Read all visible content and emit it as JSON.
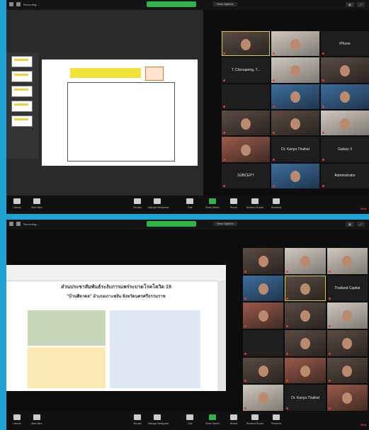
{
  "colors": {
    "background": "#1fa3d6",
    "accent_green": "#2fb34a",
    "active_speaker": "#d6d03c",
    "end": "#e8493f"
  },
  "frame1": {
    "topbar": {
      "left_text": "Recording...",
      "view": "View Options"
    },
    "tiles": [
      {
        "name": "",
        "cam": "cam",
        "active": true
      },
      {
        "name": "",
        "cam": "cam2"
      },
      {
        "name": "iPhone",
        "cam": ""
      },
      {
        "name": "T. Chirnapong, T...",
        "cam": ""
      },
      {
        "name": "",
        "cam": "cam2"
      },
      {
        "name": "",
        "cam": "cam"
      },
      {
        "name": "",
        "cam": ""
      },
      {
        "name": "",
        "cam": "cam4"
      },
      {
        "name": "",
        "cam": "cam4"
      },
      {
        "name": "",
        "cam": "cam"
      },
      {
        "name": "",
        "cam": "cam"
      },
      {
        "name": "",
        "cam": "cam2"
      },
      {
        "name": "",
        "cam": "cam3"
      },
      {
        "name": "Dr. Kanya Thaihal",
        "cam": ""
      },
      {
        "name": "Galaxy 3",
        "cam": ""
      },
      {
        "name": "SUBCEPT",
        "cam": ""
      },
      {
        "name": "",
        "cam": "cam4"
      },
      {
        "name": "Administrator",
        "cam": ""
      }
    ]
  },
  "frame2": {
    "topbar": {
      "left_text": "Recording...",
      "view": "View Options"
    },
    "doc": {
      "title": "ส่วนประชาสัมพันธ์ระงับการแพร่ระบาดโรคโควิด 19",
      "subtitle": "\"บ้านศิลาดล\" อำเภอเกาะพงัน จังหวัดนครศรีธรรมราช"
    },
    "tiles": [
      {
        "name": "",
        "cam": "cam"
      },
      {
        "name": "",
        "cam": "cam2"
      },
      {
        "name": "",
        "cam": "cam2"
      },
      {
        "name": "",
        "cam": "cam4"
      },
      {
        "name": "",
        "cam": "cam",
        "active": true
      },
      {
        "name": "Thailand Capital",
        "cam": ""
      },
      {
        "name": "",
        "cam": "cam3"
      },
      {
        "name": "",
        "cam": "cam"
      },
      {
        "name": "",
        "cam": "cam2"
      },
      {
        "name": "",
        "cam": ""
      },
      {
        "name": "",
        "cam": "cam"
      },
      {
        "name": "",
        "cam": "cam"
      },
      {
        "name": "",
        "cam": "cam"
      },
      {
        "name": "",
        "cam": "cam3"
      },
      {
        "name": "",
        "cam": "cam"
      },
      {
        "name": "",
        "cam": "cam2"
      },
      {
        "name": "Dr. Kanya Thaihal",
        "cam": ""
      },
      {
        "name": "",
        "cam": "cam3"
      }
    ]
  },
  "toolbar": [
    {
      "label": "Unmute",
      "icon": "mic-icon"
    },
    {
      "label": "Start Video",
      "icon": "video-icon"
    },
    {
      "label": "Security",
      "icon": "shield-icon"
    },
    {
      "label": "Manage Participants",
      "icon": "participants-icon"
    },
    {
      "label": "Chat",
      "icon": "chat-icon"
    },
    {
      "label": "Share Screen",
      "icon": "share-icon",
      "green": true
    },
    {
      "label": "Record",
      "icon": "record-icon"
    },
    {
      "label": "Breakout Rooms",
      "icon": "rooms-icon"
    },
    {
      "label": "Reactions",
      "icon": "reactions-icon"
    }
  ],
  "end_label": "End"
}
